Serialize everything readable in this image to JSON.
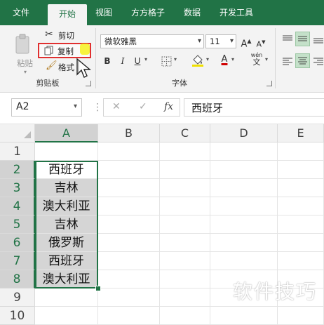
{
  "tabs": [
    {
      "label": "文件"
    },
    {
      "label": "开始"
    },
    {
      "label": "视图"
    },
    {
      "label": "方方格子"
    },
    {
      "label": "数据"
    },
    {
      "label": "开发工具"
    }
  ],
  "ribbon": {
    "clipboard": {
      "paste_label": "粘贴",
      "cut_label": "剪切",
      "copy_label": "复制",
      "format_painter_label": "格式",
      "group_label": "剪贴板"
    },
    "font": {
      "font_name": "微软雅黑",
      "font_size": "11",
      "grow_label": "A",
      "shrink_label": "A",
      "bold_label": "B",
      "italic_label": "I",
      "underline_label": "U",
      "font_color_label": "A",
      "phonetic_label": "wén",
      "phonetic_sub": "文",
      "group_label": "字体"
    }
  },
  "formula_bar": {
    "name_box": "A2",
    "cancel_symbol": "✕",
    "enter_symbol": "✓",
    "fx_label": "fx",
    "content": "西班牙"
  },
  "columns": [
    "A",
    "B",
    "C",
    "D",
    "E"
  ],
  "rows": [
    "1",
    "2",
    "3",
    "4",
    "5",
    "6",
    "7",
    "8",
    "9",
    "10"
  ],
  "column_a_values": [
    "",
    "西班牙",
    "吉林",
    "澳大利亚",
    "吉林",
    "俄罗斯",
    "西班牙",
    "澳大利亚",
    "",
    ""
  ],
  "watermark": "软件技巧",
  "colors": {
    "accent": "#217346",
    "copy_highlight": "#e03030",
    "selection_fill": "#d5d5d5"
  }
}
